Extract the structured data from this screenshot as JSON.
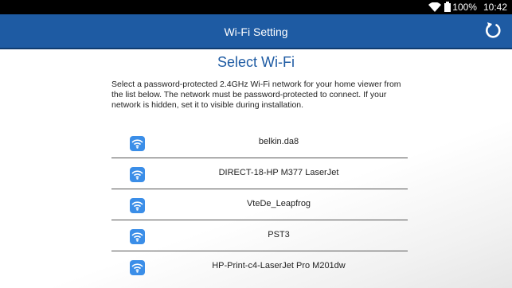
{
  "status_bar": {
    "battery_text": "100%",
    "time": "10:42"
  },
  "app_bar": {
    "title": "Wi-Fi Setting"
  },
  "main": {
    "heading": "Select Wi-Fi",
    "description": "Select a password-protected 2.4GHz Wi-Fi network for your home viewer from the list below. The network must be password-protected to connect. If your network is hidden, set it to visible during installation."
  },
  "networks": [
    {
      "ssid": "belkin.da8"
    },
    {
      "ssid": "DIRECT-18-HP M377 LaserJet"
    },
    {
      "ssid": "VteDe_Leapfrog"
    },
    {
      "ssid": "PST3"
    },
    {
      "ssid": "HP-Print-c4-LaserJet Pro M201dw"
    }
  ],
  "colors": {
    "app_bar": "#1e5ba3",
    "accent": "#1e5ba3",
    "wifi_icon_bg": "#3b8ee8"
  }
}
